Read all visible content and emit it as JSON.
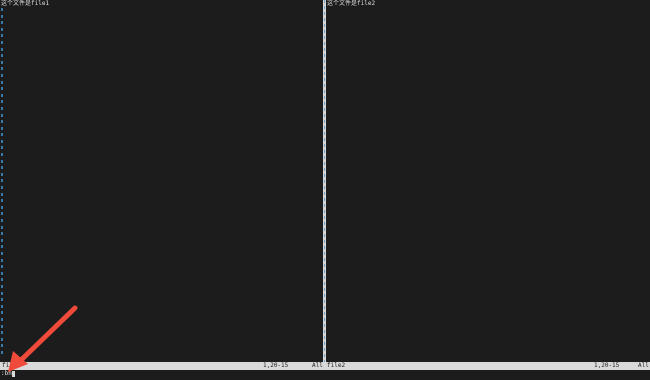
{
  "left_pane": {
    "content": "这个文件是file1"
  },
  "right_pane": {
    "content": "这个文件是file2"
  },
  "statusbar": {
    "left_file": "file1",
    "left_position": "1,20-15",
    "left_scroll": "All",
    "right_file": "file2",
    "right_position": "1,20-15",
    "right_scroll": "All"
  },
  "command": {
    "text": ":bn"
  },
  "colors": {
    "background": "#1c1c1c",
    "statusbar": "#d9d9d9",
    "tilde": "#3a7fb0",
    "arrow": "#f04a3a"
  }
}
